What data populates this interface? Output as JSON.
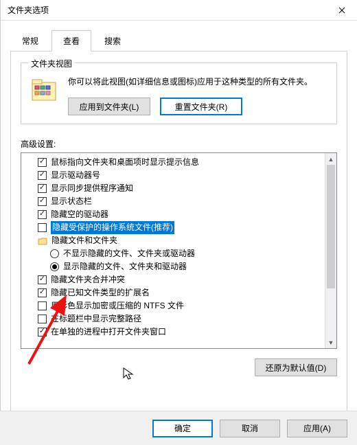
{
  "title": "文件夹选项",
  "tabs": {
    "general": "常规",
    "view": "查看",
    "search": "搜索"
  },
  "group": {
    "legend": "文件夹视图",
    "text": "你可以将此视图(如详细信息或图标)应用于这种类型的所有文件夹。",
    "apply_btn": "应用到文件夹(L)",
    "reset_btn": "重置文件夹(R)"
  },
  "advanced_label": "高级设置:",
  "items": [
    {
      "kind": "check",
      "indent": 1,
      "checked": true,
      "label": "鼠标指向文件夹和桌面项时显示提示信息"
    },
    {
      "kind": "check",
      "indent": 1,
      "checked": true,
      "label": "显示驱动器号"
    },
    {
      "kind": "check",
      "indent": 1,
      "checked": true,
      "label": "显示同步提供程序通知"
    },
    {
      "kind": "check",
      "indent": 1,
      "checked": true,
      "label": "显示状态栏"
    },
    {
      "kind": "check",
      "indent": 1,
      "checked": true,
      "label": "隐藏空的驱动器"
    },
    {
      "kind": "check",
      "indent": 1,
      "checked": false,
      "label": "隐藏受保护的操作系统文件(推荐)",
      "selected": true
    },
    {
      "kind": "folder",
      "indent": 1,
      "label": "隐藏文件和文件夹"
    },
    {
      "kind": "radio",
      "indent": 2,
      "checked": false,
      "label": "不显示隐藏的文件、文件夹或驱动器"
    },
    {
      "kind": "radio",
      "indent": 2,
      "checked": true,
      "label": "显示隐藏的文件、文件夹和驱动器"
    },
    {
      "kind": "check",
      "indent": 1,
      "checked": true,
      "label": "隐藏文件夹合并冲突"
    },
    {
      "kind": "check",
      "indent": 1,
      "checked": true,
      "label": "隐藏已知文件类型的扩展名"
    },
    {
      "kind": "check",
      "indent": 1,
      "checked": false,
      "label": "用彩色显示加密或压缩的 NTFS 文件"
    },
    {
      "kind": "check",
      "indent": 1,
      "checked": false,
      "label": "在标题栏中显示完整路径"
    },
    {
      "kind": "check",
      "indent": 1,
      "checked": true,
      "label": "在单独的进程中打开文件夹窗口"
    }
  ],
  "restore_btn": "还原为默认值(D)",
  "bottom": {
    "ok": "确定",
    "cancel": "取消",
    "apply": "应用(A)"
  }
}
